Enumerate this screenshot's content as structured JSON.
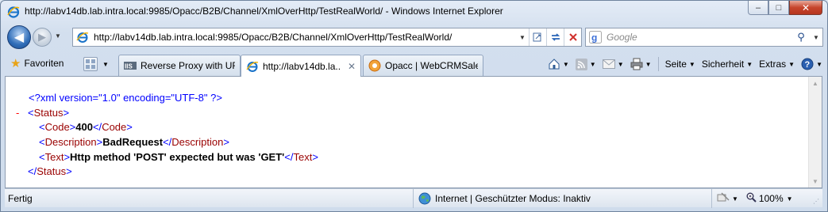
{
  "window": {
    "title": "http://labv14db.lab.intra.local:9985/Opacc/B2B/Channel/XmlOverHttp/TestRealWorld/ - Windows Internet Explorer",
    "controls": {
      "minimize": "–",
      "maximize": "□",
      "close": "✕"
    }
  },
  "address_bar": {
    "url": "http://labv14db.lab.intra.local:9985/Opacc/B2B/Channel/XmlOverHttp/TestRealWorld/"
  },
  "search": {
    "placeholder": "Google"
  },
  "favorites": {
    "label": "Favoriten"
  },
  "tabs": [
    {
      "label": "Reverse Proxy with UR...",
      "icon": "iis-icon",
      "active": false
    },
    {
      "label": "http://labv14db.la...",
      "icon": "ie-page-icon",
      "active": true
    },
    {
      "label": "Opacc | WebCRMSale...",
      "icon": "opacc-icon",
      "active": false
    }
  ],
  "commands": {
    "page": "Seite",
    "safety": "Sicherheit",
    "extras": "Extras"
  },
  "xml": {
    "declaration": "<?xml version=\"1.0\" encoding=\"UTF-8\" ?>",
    "collapse_marker": "-",
    "root_open": "Status",
    "root_close": "Status",
    "children": [
      {
        "name": "Code",
        "value": "400"
      },
      {
        "name": "Description",
        "value": "BadRequest"
      },
      {
        "name": "Text",
        "value": "Http method 'POST' expected but was 'GET'"
      }
    ]
  },
  "status_bar": {
    "left": "Fertig",
    "zone": "Internet | Geschützter Modus: Inaktiv",
    "zoom": "100%"
  },
  "colors": {
    "xml_tag": "#990000",
    "xml_bracket": "#0000ff",
    "xml_decl": "#0000ff",
    "collapse": "#ff0000"
  }
}
